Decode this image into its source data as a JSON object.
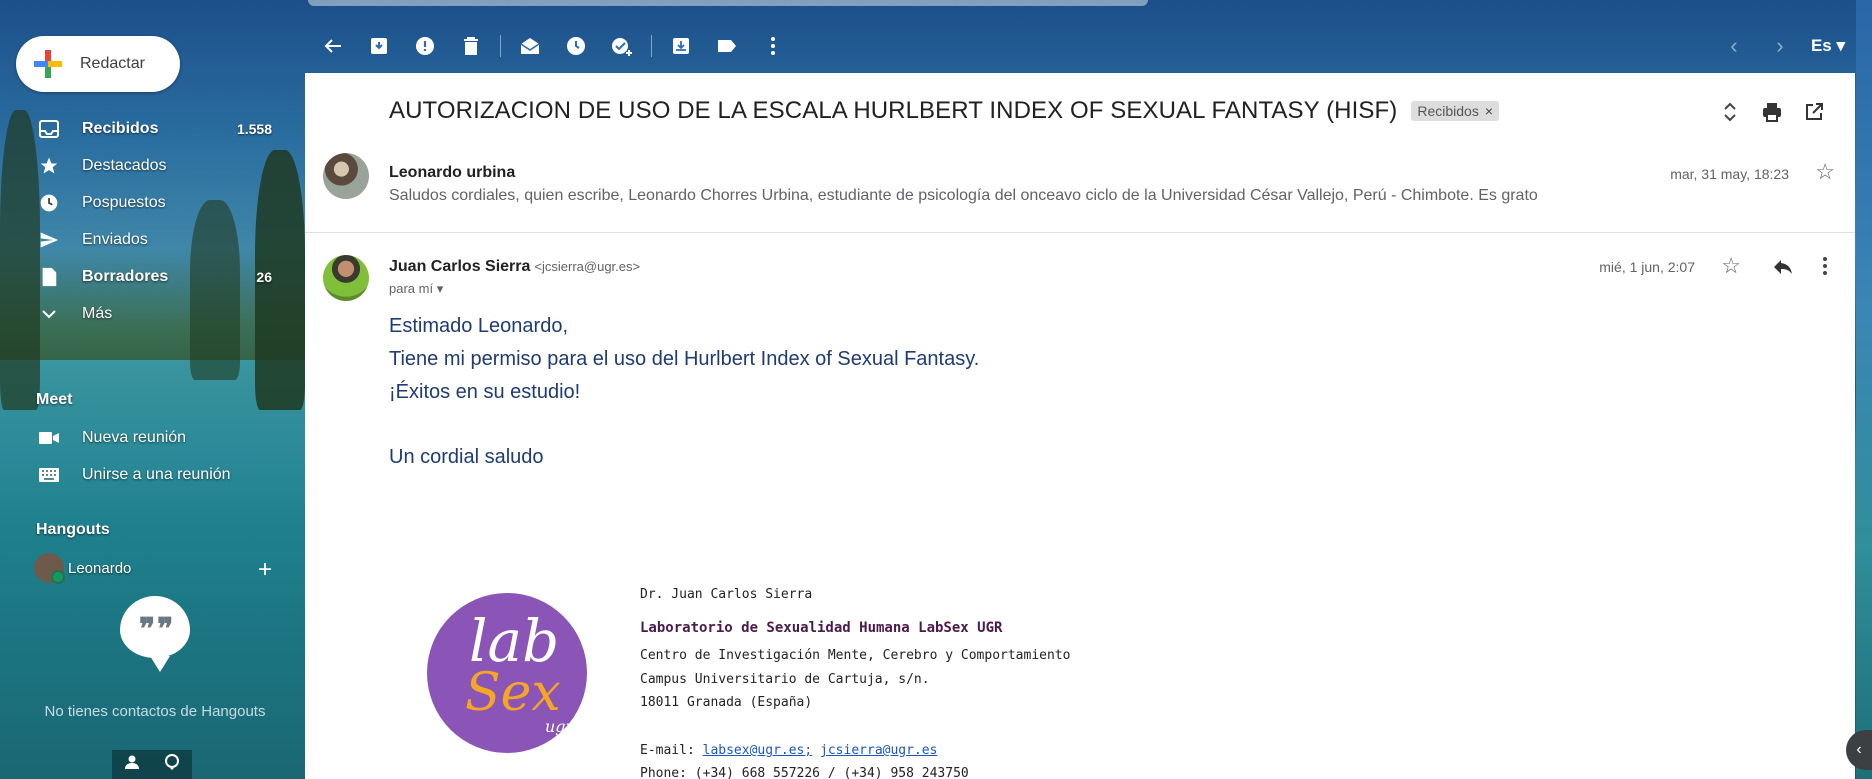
{
  "compose": {
    "label": "Redactar"
  },
  "nav": [
    {
      "label": "Recibidos",
      "count": "1.558",
      "icon": "inbox-icon",
      "bold": true
    },
    {
      "label": "Destacados",
      "count": "",
      "icon": "star-icon",
      "bold": false
    },
    {
      "label": "Pospuestos",
      "count": "",
      "icon": "clock-icon",
      "bold": false
    },
    {
      "label": "Enviados",
      "count": "",
      "icon": "send-icon",
      "bold": false
    },
    {
      "label": "Borradores",
      "count": "26",
      "icon": "draft-icon",
      "bold": true
    },
    {
      "label": "Más",
      "count": "",
      "icon": "chevron-down-icon",
      "bold": false
    }
  ],
  "meet": {
    "title": "Meet",
    "new_meeting": "Nueva reunión",
    "join_meeting": "Unirse a una reunión"
  },
  "hangouts": {
    "title": "Hangouts",
    "user": "Leonardo",
    "no_contacts": "No tienes contactos de Hangouts"
  },
  "toolbar": {
    "language": "Es"
  },
  "thread": {
    "subject": "AUTORIZACION DE USO DE LA ESCALA HURLBERT INDEX OF SEXUAL FANTASY (HISF)",
    "label": "Recibidos",
    "label_close": "×"
  },
  "message1": {
    "sender": "Leonardo urbina",
    "date": "mar, 31 may, 18:23",
    "snippet": "Saludos cordiales, quien escribe, Leonardo Chorres Urbina, estudiante de psicología del onceavo ciclo de la Universidad César Vallejo, Perú - Chimbote. Es grato"
  },
  "message2": {
    "sender": "Juan Carlos Sierra",
    "email": "<jcsierra@ugr.es>",
    "to": "para mí",
    "date": "mié, 1 jun, 2:07",
    "body": [
      "Estimado Leonardo,",
      "Tiene mi permiso para el uso del Hurlbert Index of Sexual Fantasy.",
      "¡Éxitos en su estudio!",
      "Un cordial saludo"
    ]
  },
  "signature": {
    "logo_lab": "lab",
    "logo_sex": "Sex",
    "logo_ugr": "ugr",
    "name": "Dr. Juan Carlos Sierra",
    "lab": "Laboratorio de Sexualidad Humana LabSex UGR",
    "center": "Centro de Investigación Mente, Cerebro y Comportamiento",
    "campus": "Campus Universitario de Cartuja, s/n.",
    "city": "18011 Granada (España)",
    "email_label": "E-mail:",
    "email1": "labsex@ugr.es;",
    "email2": "jcsierra@ugr.es",
    "phone": "Phone: (+34) 668 557226 / (+34) 958 243750"
  },
  "colors": {
    "accent_blue": "#1f3b73",
    "logo_purple": "#8b55b8",
    "logo_orange": "#f6a623"
  }
}
